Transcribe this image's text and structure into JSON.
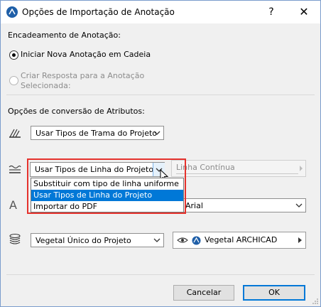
{
  "window": {
    "title": "Opções de Importação de Anotação",
    "help_label": "?",
    "close_label": "✕"
  },
  "annotation_chaining": {
    "heading": "Encadeamento de Anotação:",
    "option_new": "Iniciar Nova Anotação em Cadeia",
    "option_reply": "Criar Resposta para a Anotação Selecionada:",
    "selected": "option_new"
  },
  "attribute_conversion": {
    "heading": "Opções de conversão de Atributos:",
    "fill_type": {
      "value": "Usar Tipos de Trama do Projeto",
      "icon": "fill-pattern-icon"
    },
    "line_type": {
      "value": "Usar Tipos de Linha do Projeto",
      "icon": "line-type-icon",
      "options": [
        "Substituir com tipo de linha uniforme",
        "Usar Tipos de Linha do Projeto",
        "Importar do PDF"
      ],
      "highlighted_index": 1,
      "uniform_line_value": "Linha Contínua"
    },
    "font": {
      "value": "Arial",
      "icon": "font-icon",
      "icon_glyph": "A"
    },
    "surface": {
      "value": "Vegetal Único do Projeto",
      "icon": "layers-icon",
      "surface_value": "Vegetal ARCHICAD"
    }
  },
  "buttons": {
    "cancel": "Cancelar",
    "ok": "OK"
  },
  "colors": {
    "accent": "#0078d7",
    "highlight_frame": "#e5322d",
    "app_icon": "#1f5fa8"
  }
}
